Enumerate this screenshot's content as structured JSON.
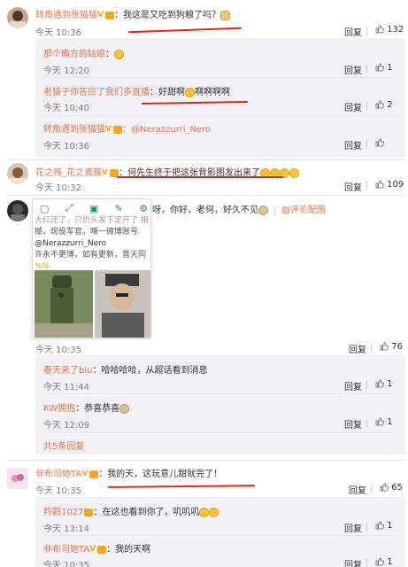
{
  "comments": [
    {
      "name": "转角遇到张猫猫",
      "text": "我这是又吃到狗粮了吗？",
      "time": "今天 10:36",
      "reply": "回复",
      "likes": "132"
    },
    {
      "name": "花之殇_花之鳶簇",
      "text": "何先生终于把这张背影图发出来了",
      "time": "今天 10:32",
      "reply": "回复",
      "likes": "109"
    },
    {
      "post_text_after": "呀，你好，老何，好久不见",
      "report": "评论配图",
      "time": "今天 10:35",
      "reply": "回复",
      "likes": "76"
    },
    {
      "name": "非布司她TA",
      "text": "我的天，这玩意儿甜就完了！",
      "time": "今天 10:35",
      "reply": "回复",
      "likes": "65"
    }
  ],
  "replies1": [
    {
      "name": "那个南方的姑娘",
      "text": "：",
      "time": "今天 12:20",
      "reply": "回复",
      "likes": "1"
    },
    {
      "name": "老猫子你答应了我们多直播",
      "text": "：好甜啊",
      "text2": "啊啊啊啊",
      "time": "今天 10:40",
      "reply": "回复",
      "likes": "2"
    },
    {
      "name": "转角遇到张猫猫",
      "text": "：@Nerazzurri_Nero",
      "time": "今天 10:36",
      "reply": "回复",
      "likes": ""
    }
  ],
  "replies3": [
    {
      "name": "春天来了blu",
      "text": "：哈哈哈哈，从超话看到消息",
      "time": "今天 11:44",
      "reply": "回复",
      "likes": "1"
    },
    {
      "name": "KW拥抱",
      "text": "：恭喜恭喜",
      "time": "今天 12:09",
      "reply": "回复",
      "likes": "1"
    }
  ],
  "more_replies": "共5条回复",
  "replies4": [
    {
      "name": "羚鹳1027",
      "text": "：在这也看到你了，叽叽叽",
      "time": "今天 13:14",
      "reply": "回复",
      "likes": "1"
    },
    {
      "name": "非布司她TA",
      "text": "：我的天啊",
      "time": "今天 10:35",
      "reply": "回复",
      "likes": "1"
    }
  ],
  "popup": {
    "lines": [
      "大红还了，只扔头发下定开了 相关",
      "撼，现役军官。唯一微博账号",
      "@Nerazzurri_Nero",
      "许永不更博，如有更新，晋天同",
      "%%"
    ]
  },
  "colors": {
    "accent": "#eb7350",
    "underline": "#d9281f",
    "box": "#f2f2f5"
  }
}
